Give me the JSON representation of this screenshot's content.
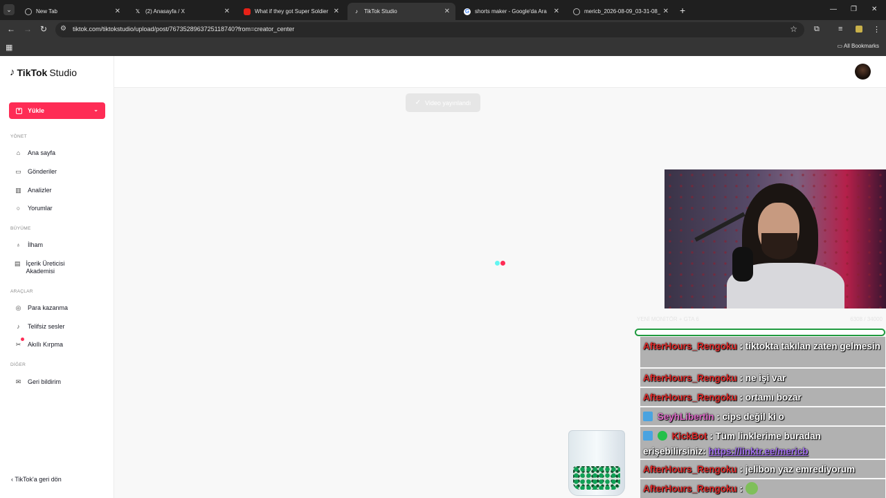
{
  "browser": {
    "tabs": [
      {
        "title": "New Tab",
        "icon": "globe-icon",
        "active": false
      },
      {
        "title": "(2) Anasayfa / X",
        "icon": "x-logo-icon",
        "active": false
      },
      {
        "title": "What if they got Super Soldier",
        "icon": "youtube-icon",
        "active": false
      },
      {
        "title": "TikTok Studio",
        "icon": "tiktok-icon",
        "active": true
      },
      {
        "title": "shorts maker - Google'da Ara",
        "icon": "google-icon",
        "active": false
      },
      {
        "title": "mericb_2026-08-09_03-31-08_",
        "icon": "globe-icon",
        "active": false
      }
    ],
    "url": "tiktok.com/tiktokstudio/upload/post/7673528963725118740?from=creator_center",
    "bookmarks_label": "All Bookmarks"
  },
  "sidebar": {
    "logo_brand": "TikTok",
    "logo_product": "Studio",
    "upload_label": "Yükle",
    "sections": [
      {
        "title": "YÖNET",
        "items": [
          {
            "label": "Ana sayfa",
            "icon": "home-icon"
          },
          {
            "label": "Gönderiler",
            "icon": "folder-icon"
          },
          {
            "label": "Analizler",
            "icon": "chart-icon"
          },
          {
            "label": "Yorumlar",
            "icon": "comment-icon"
          }
        ]
      },
      {
        "title": "BÜYÜME",
        "items": [
          {
            "label": "İlham",
            "icon": "lightbulb-icon"
          },
          {
            "label": "İçerik Üreticisi Akademisi",
            "icon": "book-icon"
          }
        ]
      },
      {
        "title": "ARAÇLAR",
        "items": [
          {
            "label": "Para kazanma",
            "icon": "money-icon"
          },
          {
            "label": "Telifsiz sesler",
            "icon": "music-icon"
          },
          {
            "label": "Akıllı Kırpma",
            "icon": "scissors-icon"
          }
        ]
      },
      {
        "title": "DİĞER",
        "items": [
          {
            "label": "Geri bildirim",
            "icon": "mail-icon"
          }
        ]
      }
    ],
    "back_label": "TikTok'a geri dön"
  },
  "main": {
    "toast": "Video yayınlandı"
  },
  "stream": {
    "info_left": "YENİ MONİTÖR + GTA 6",
    "info_right": "6308 / 34000",
    "chat": [
      {
        "user": "AfterHours_Rengoku",
        "text": ": tiktokta takılan zaten gelmesin"
      },
      {
        "user": "AfterHours_Rengoku",
        "text": ": ne işi var"
      },
      {
        "user": "AfterHours_Rengoku",
        "text": ": ortamı bozar"
      },
      {
        "user": "SeyhLibertin",
        "text": ": cips değil ki o"
      },
      {
        "user": "KickBot",
        "text": ": Tüm linklerime buradan erişebilirsiniz: ",
        "link": "https://linktr.ee/mericb"
      },
      {
        "user": "AfterHours_Rengoku",
        "text": ": jelibon yaz emrediyorum"
      },
      {
        "user": "AfterHours_Rengoku",
        "text": ":"
      }
    ]
  }
}
